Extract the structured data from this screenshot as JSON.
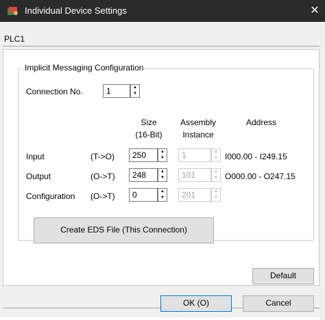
{
  "window": {
    "title": "Individual Device Settings",
    "close_glyph": "✕"
  },
  "tab": {
    "label": "PLC1"
  },
  "group": {
    "title": "Implicit Messaging Configuration"
  },
  "connection": {
    "label": "Connection No.",
    "value": "1"
  },
  "columns": {
    "size": "Size",
    "size_unit": "(16-Bit)",
    "assembly": "Assembly",
    "instance": "Instance",
    "address": "Address"
  },
  "rows": [
    {
      "label": "Input",
      "direction": "(T->O)",
      "size": "250",
      "instance": "1",
      "address": "I000.00 - I249.15"
    },
    {
      "label": "Output",
      "direction": "(O->T)",
      "size": "248",
      "instance": "101",
      "address": "O000.00 - O247.15"
    },
    {
      "label": "Configuration",
      "direction": "(O->T)",
      "size": "0",
      "instance": "201",
      "address": ""
    }
  ],
  "buttons": {
    "create_eds": "Create EDS File (This Connection)",
    "default": "Default",
    "ok": "OK (O)",
    "cancel": "Cancel"
  },
  "icons": {
    "app": "settings-window-icon",
    "spin_up": "▲",
    "spin_down": "▼"
  },
  "colors": {
    "titlebar": "#2b2b2b",
    "dialog": "#f0f0f0",
    "primary_border": "#0078d7"
  }
}
